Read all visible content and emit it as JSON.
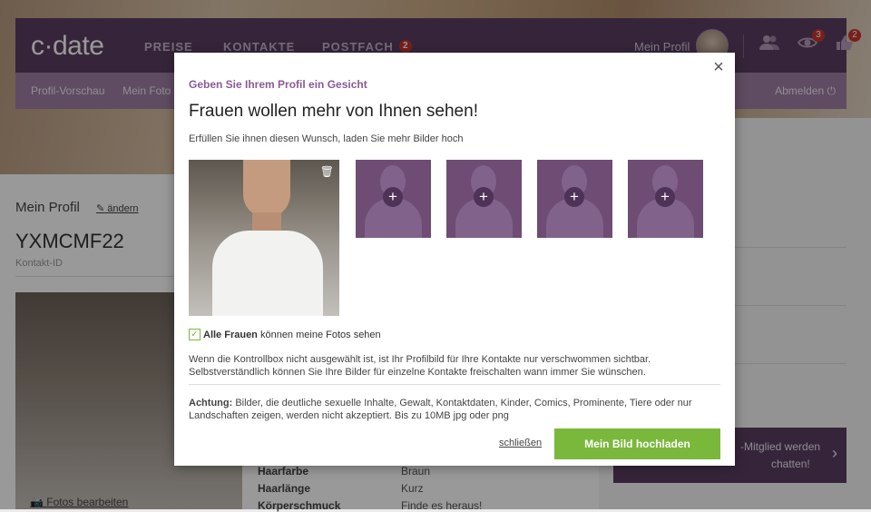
{
  "header": {
    "logo": "c·date",
    "nav": [
      {
        "label": "PREISE"
      },
      {
        "label": "KONTAKTE"
      },
      {
        "label": "POSTFACH",
        "badge": "2"
      }
    ],
    "my_profile": "Mein Profil",
    "icons": [
      {
        "name": "contacts-icon",
        "badge": ""
      },
      {
        "name": "eye-icon",
        "badge": "3"
      },
      {
        "name": "thumbs-up-icon",
        "badge": "2"
      }
    ]
  },
  "subnav": {
    "items": [
      "Profil-Vorschau",
      "Mein Foto"
    ],
    "logout": "Abmelden"
  },
  "profile": {
    "title": "Mein Profil",
    "edit_link": "ändern",
    "username": "YXMCMF22",
    "contact_id_label": "Kontakt-ID",
    "photos_edit": "Fotos bearbeiten",
    "details": [
      {
        "label": "Haarfarbe",
        "value": "Braun"
      },
      {
        "label": "Haarlänge",
        "value": "Kurz"
      },
      {
        "label": "Körperschmuck",
        "value": "Finde es heraus!"
      }
    ]
  },
  "promo": {
    "text_line1": "-Mitglied werden",
    "text_line2": "chatten!"
  },
  "modal": {
    "subtitle": "Geben Sie Ihrem Profil ein Gesicht",
    "title": "Frauen wollen mehr von Ihnen sehen!",
    "description": "Erfüllen Sie ihnen diesen Wunsch, laden Sie mehr Bilder hoch",
    "slots_count": 4,
    "checkbox_bold": "Alle Frauen",
    "checkbox_rest": " können meine Fotos sehen",
    "info_line1": "Wenn die Kontrollbox nicht ausgewählt ist, ist Ihr Profilbild für Ihre Kontakte nur verschwommen sichtbar.",
    "info_line2": "Selbstverständlich können Sie Ihre Bilder für einzelne Kontakte freischalten wann immer Sie wünschen.",
    "warning_bold": "Achtung:",
    "warning_text": " Bilder, die deutliche sexuelle Inhalte, Gewalt, Kontaktdaten, Kinder, Comics, Prominente, Tiere oder nur Landschaften zeigen, werden nicht akzeptiert. Bis zu 10MB jpg oder png",
    "close_link": "schließen",
    "upload_button": "Mein Bild hochladen"
  },
  "colors": {
    "brand_purple": "#5b3f62",
    "subnav_purple": "#9e7fa3",
    "accent_green": "#7ab83c",
    "badge_red": "#c9342e"
  }
}
